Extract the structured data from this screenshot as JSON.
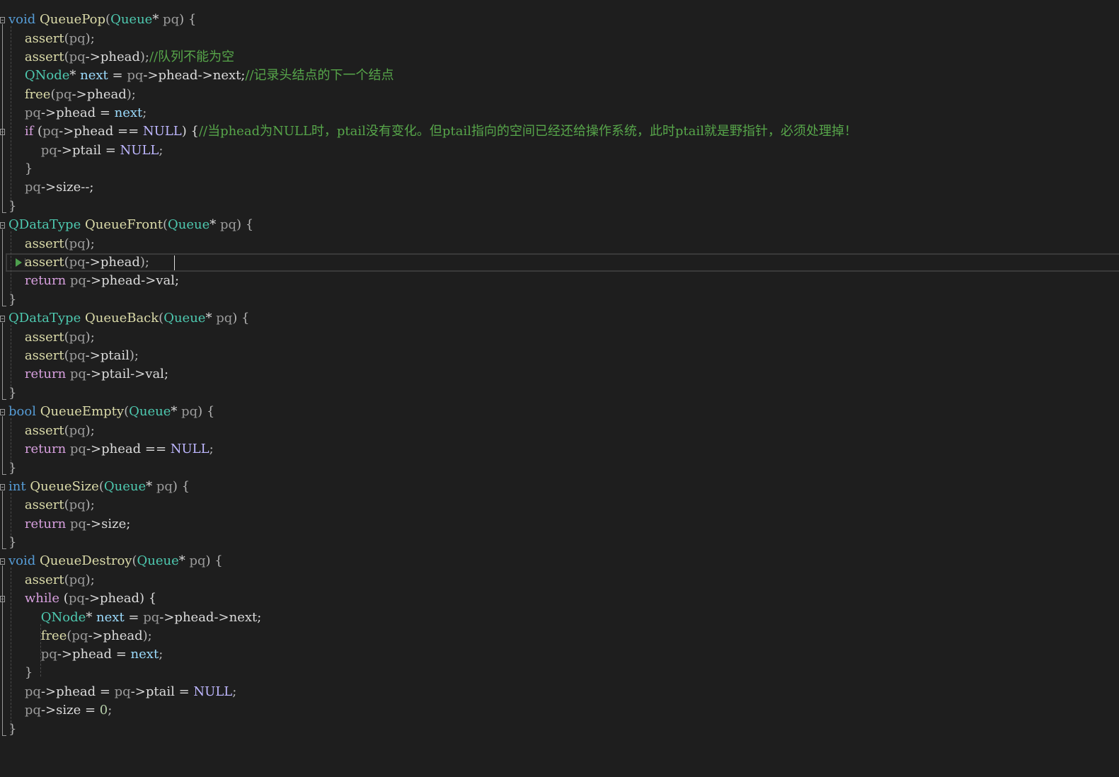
{
  "editor": {
    "colors": {
      "background": "#1e1e1e",
      "keyword": "#569cd6",
      "control": "#d8a0df",
      "type": "#4ec9b0",
      "function": "#dcdcaa",
      "parameter": "#9a9a9a",
      "local": "#9cdcfe",
      "macro": "#beb7ff",
      "number": "#b5cea8",
      "comment": "#57a64a",
      "text": "#dcdcdc"
    },
    "icons": [
      "fold-collapse-icon",
      "breakpoint-arrow-icon"
    ],
    "lines": [
      {
        "tokens": [
          [
            "kw",
            "void"
          ],
          [
            "id",
            " "
          ],
          [
            "fn",
            "QueuePop"
          ],
          [
            "pun",
            "("
          ],
          [
            "ty",
            "Queue"
          ],
          [
            "id",
            "* "
          ],
          [
            "prm",
            "pq"
          ],
          [
            "pun",
            ") {"
          ]
        ]
      },
      {
        "tokens": [
          [
            "id",
            "    "
          ],
          [
            "fn",
            "assert"
          ],
          [
            "pun",
            "("
          ],
          [
            "prm",
            "pq"
          ],
          [
            "pun",
            ");"
          ]
        ]
      },
      {
        "tokens": [
          [
            "id",
            "    "
          ],
          [
            "fn",
            "assert"
          ],
          [
            "pun",
            "("
          ],
          [
            "prm",
            "pq"
          ],
          [
            "id",
            "->phead"
          ],
          [
            "pun",
            ");"
          ],
          [
            "cmt",
            "//队列不能为空"
          ]
        ]
      },
      {
        "tokens": [
          [
            "id",
            "    "
          ],
          [
            "ty",
            "QNode"
          ],
          [
            "id",
            "* "
          ],
          [
            "loc",
            "next"
          ],
          [
            "id",
            " = "
          ],
          [
            "prm",
            "pq"
          ],
          [
            "id",
            "->phead->next;"
          ],
          [
            "cmt",
            "//记录头结点的下一个结点"
          ]
        ]
      },
      {
        "tokens": [
          [
            "id",
            "    "
          ],
          [
            "fn",
            "free"
          ],
          [
            "pun",
            "("
          ],
          [
            "prm",
            "pq"
          ],
          [
            "id",
            "->phead"
          ],
          [
            "pun",
            ");"
          ]
        ]
      },
      {
        "tokens": [
          [
            "id",
            "    "
          ],
          [
            "prm",
            "pq"
          ],
          [
            "id",
            "->phead = "
          ],
          [
            "loc",
            "next"
          ],
          [
            "pun",
            ";"
          ]
        ]
      },
      {
        "tokens": [
          [
            "id",
            "    "
          ],
          [
            "ctl",
            "if"
          ],
          [
            "id",
            " ("
          ],
          [
            "prm",
            "pq"
          ],
          [
            "id",
            "->phead == "
          ],
          [
            "mac",
            "NULL"
          ],
          [
            "id",
            ") {"
          ],
          [
            "cmt",
            "//当phead为NULL时，ptail没有变化。但ptail指向的空间已经还给操作系统，此时ptail就是野指针，必须处理掉！"
          ]
        ]
      },
      {
        "tokens": [
          [
            "id",
            "        "
          ],
          [
            "prm",
            "pq"
          ],
          [
            "id",
            "->ptail = "
          ],
          [
            "mac",
            "NULL"
          ],
          [
            "pun",
            ";"
          ]
        ]
      },
      {
        "tokens": [
          [
            "id",
            "    "
          ],
          [
            "pun",
            "}"
          ]
        ]
      },
      {
        "tokens": [
          [
            "id",
            "    "
          ],
          [
            "prm",
            "pq"
          ],
          [
            "id",
            "->size--;"
          ]
        ]
      },
      {
        "tokens": [
          [
            "pun",
            "}"
          ]
        ]
      },
      {
        "tokens": [
          [
            "ty",
            "QDataType"
          ],
          [
            "id",
            " "
          ],
          [
            "fn",
            "QueueFront"
          ],
          [
            "pun",
            "("
          ],
          [
            "ty",
            "Queue"
          ],
          [
            "id",
            "* "
          ],
          [
            "prm",
            "pq"
          ],
          [
            "pun",
            ") {"
          ]
        ]
      },
      {
        "tokens": [
          [
            "id",
            "    "
          ],
          [
            "fn",
            "assert"
          ],
          [
            "pun",
            "("
          ],
          [
            "prm",
            "pq"
          ],
          [
            "pun",
            ");"
          ]
        ]
      },
      {
        "tokens": [
          [
            "id",
            "    "
          ],
          [
            "fn",
            "assert"
          ],
          [
            "pun",
            "("
          ],
          [
            "prm",
            "pq"
          ],
          [
            "id",
            "->phead"
          ],
          [
            "pun",
            ");"
          ]
        ]
      },
      {
        "tokens": [
          [
            "id",
            "    "
          ],
          [
            "ctl",
            "return"
          ],
          [
            "id",
            " "
          ],
          [
            "prm",
            "pq"
          ],
          [
            "id",
            "->phead->val;"
          ]
        ]
      },
      {
        "tokens": [
          [
            "pun",
            "}"
          ]
        ]
      },
      {
        "tokens": [
          [
            "ty",
            "QDataType"
          ],
          [
            "id",
            " "
          ],
          [
            "fn",
            "QueueBack"
          ],
          [
            "pun",
            "("
          ],
          [
            "ty",
            "Queue"
          ],
          [
            "id",
            "* "
          ],
          [
            "prm",
            "pq"
          ],
          [
            "pun",
            ") {"
          ]
        ]
      },
      {
        "tokens": [
          [
            "id",
            "    "
          ],
          [
            "fn",
            "assert"
          ],
          [
            "pun",
            "("
          ],
          [
            "prm",
            "pq"
          ],
          [
            "pun",
            ");"
          ]
        ]
      },
      {
        "tokens": [
          [
            "id",
            "    "
          ],
          [
            "fn",
            "assert"
          ],
          [
            "pun",
            "("
          ],
          [
            "prm",
            "pq"
          ],
          [
            "id",
            "->ptail"
          ],
          [
            "pun",
            ");"
          ]
        ]
      },
      {
        "tokens": [
          [
            "id",
            "    "
          ],
          [
            "ctl",
            "return"
          ],
          [
            "id",
            " "
          ],
          [
            "prm",
            "pq"
          ],
          [
            "id",
            "->ptail->val;"
          ]
        ]
      },
      {
        "tokens": [
          [
            "pun",
            "}"
          ]
        ]
      },
      {
        "tokens": [
          [
            "kw",
            "bool"
          ],
          [
            "id",
            " "
          ],
          [
            "fn",
            "QueueEmpty"
          ],
          [
            "pun",
            "("
          ],
          [
            "ty",
            "Queue"
          ],
          [
            "id",
            "* "
          ],
          [
            "prm",
            "pq"
          ],
          [
            "pun",
            ") {"
          ]
        ]
      },
      {
        "tokens": [
          [
            "id",
            "    "
          ],
          [
            "fn",
            "assert"
          ],
          [
            "pun",
            "("
          ],
          [
            "prm",
            "pq"
          ],
          [
            "pun",
            ");"
          ]
        ]
      },
      {
        "tokens": [
          [
            "id",
            "    "
          ],
          [
            "ctl",
            "return"
          ],
          [
            "id",
            " "
          ],
          [
            "prm",
            "pq"
          ],
          [
            "id",
            "->phead == "
          ],
          [
            "mac",
            "NULL"
          ],
          [
            "pun",
            ";"
          ]
        ]
      },
      {
        "tokens": [
          [
            "pun",
            "}"
          ]
        ]
      },
      {
        "tokens": [
          [
            "kw",
            "int"
          ],
          [
            "id",
            " "
          ],
          [
            "fn",
            "QueueSize"
          ],
          [
            "pun",
            "("
          ],
          [
            "ty",
            "Queue"
          ],
          [
            "id",
            "* "
          ],
          [
            "prm",
            "pq"
          ],
          [
            "pun",
            ") {"
          ]
        ]
      },
      {
        "tokens": [
          [
            "id",
            "    "
          ],
          [
            "fn",
            "assert"
          ],
          [
            "pun",
            "("
          ],
          [
            "prm",
            "pq"
          ],
          [
            "pun",
            ");"
          ]
        ]
      },
      {
        "tokens": [
          [
            "id",
            "    "
          ],
          [
            "ctl",
            "return"
          ],
          [
            "id",
            " "
          ],
          [
            "prm",
            "pq"
          ],
          [
            "id",
            "->size;"
          ]
        ]
      },
      {
        "tokens": [
          [
            "pun",
            "}"
          ]
        ]
      },
      {
        "tokens": [
          [
            "kw",
            "void"
          ],
          [
            "id",
            " "
          ],
          [
            "fn",
            "QueueDestroy"
          ],
          [
            "pun",
            "("
          ],
          [
            "ty",
            "Queue"
          ],
          [
            "id",
            "* "
          ],
          [
            "prm",
            "pq"
          ],
          [
            "pun",
            ") {"
          ]
        ]
      },
      {
        "tokens": [
          [
            "id",
            "    "
          ],
          [
            "fn",
            "assert"
          ],
          [
            "pun",
            "("
          ],
          [
            "prm",
            "pq"
          ],
          [
            "pun",
            ");"
          ]
        ]
      },
      {
        "tokens": [
          [
            "id",
            "    "
          ],
          [
            "ctl",
            "while"
          ],
          [
            "id",
            " ("
          ],
          [
            "prm",
            "pq"
          ],
          [
            "id",
            "->phead) {"
          ]
        ]
      },
      {
        "tokens": [
          [
            "id",
            "        "
          ],
          [
            "ty",
            "QNode"
          ],
          [
            "id",
            "* "
          ],
          [
            "loc",
            "next"
          ],
          [
            "id",
            " = "
          ],
          [
            "prm",
            "pq"
          ],
          [
            "id",
            "->phead->next;"
          ]
        ]
      },
      {
        "tokens": [
          [
            "id",
            "        "
          ],
          [
            "fn",
            "free"
          ],
          [
            "pun",
            "("
          ],
          [
            "prm",
            "pq"
          ],
          [
            "id",
            "->phead"
          ],
          [
            "pun",
            ");"
          ]
        ]
      },
      {
        "tokens": [
          [
            "id",
            "        "
          ],
          [
            "prm",
            "pq"
          ],
          [
            "id",
            "->phead = "
          ],
          [
            "loc",
            "next"
          ],
          [
            "pun",
            ";"
          ]
        ]
      },
      {
        "tokens": [
          [
            "id",
            "    "
          ],
          [
            "pun",
            "}"
          ]
        ]
      },
      {
        "tokens": [
          [
            "id",
            "    "
          ],
          [
            "prm",
            "pq"
          ],
          [
            "id",
            "->phead = "
          ],
          [
            "prm",
            "pq"
          ],
          [
            "id",
            "->ptail = "
          ],
          [
            "mac",
            "NULL"
          ],
          [
            "pun",
            ";"
          ]
        ]
      },
      {
        "tokens": [
          [
            "id",
            "    "
          ],
          [
            "prm",
            "pq"
          ],
          [
            "id",
            "->size = "
          ],
          [
            "num",
            "0"
          ],
          [
            "pun",
            ";"
          ]
        ]
      },
      {
        "tokens": [
          [
            "pun",
            "}"
          ]
        ]
      }
    ]
  }
}
